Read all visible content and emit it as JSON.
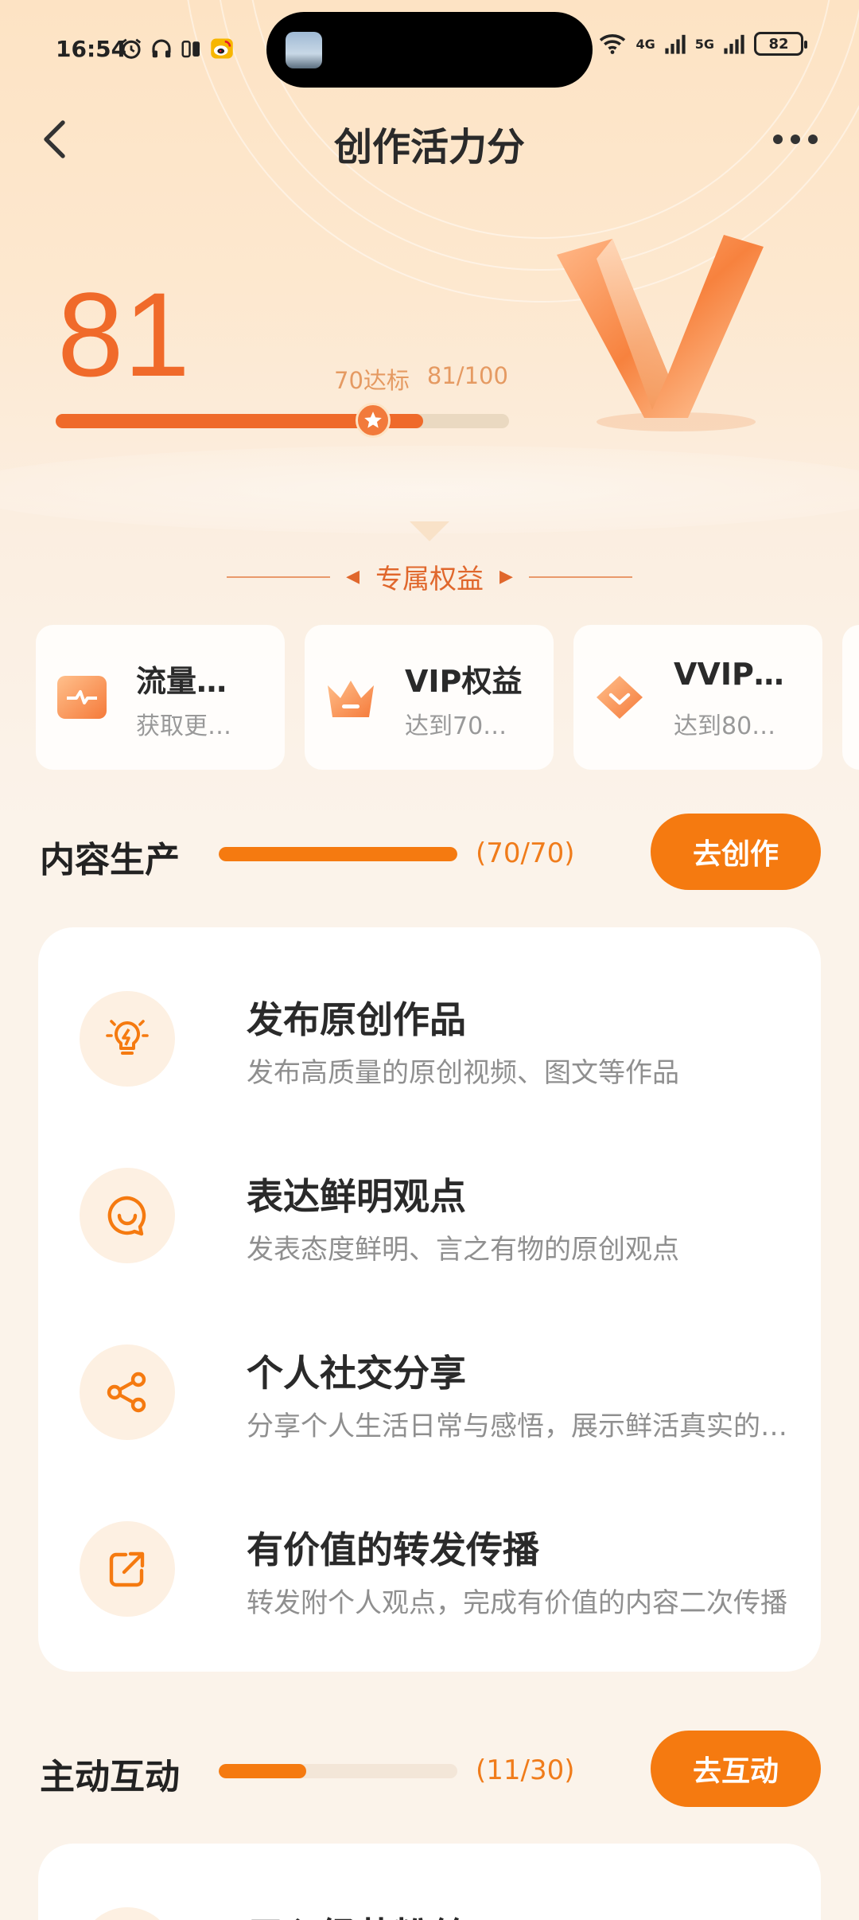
{
  "status_bar": {
    "time": "16:54",
    "net1": "4G",
    "net2": "5G",
    "battery": "82"
  },
  "header": {
    "title": "创作活力分"
  },
  "score": {
    "value": "81",
    "threshold_label": "70达标",
    "progress_label": "81/100",
    "progress": 0.81,
    "threshold": 0.7
  },
  "benefits": {
    "title": "专属权益",
    "cards": [
      {
        "title": "流量…",
        "subtitle": "获取更…"
      },
      {
        "title": "VIP权益",
        "subtitle": "达到70…"
      },
      {
        "title": "VVIP…",
        "subtitle": "达到80…"
      }
    ]
  },
  "sections": [
    {
      "title": "内容生产",
      "count": "(70/70)",
      "progress": 1.0,
      "button": "去创作",
      "tasks": [
        {
          "title": "发布原创作品",
          "subtitle": "发布高质量的原创视频、图文等作品",
          "icon": "bulb-icon"
        },
        {
          "title": "表达鲜明观点",
          "subtitle": "发表态度鲜明、言之有物的原创观点",
          "icon": "smile-chat-icon"
        },
        {
          "title": "个人社交分享",
          "subtitle": "分享个人生活日常与感悟，展示鲜活真实的…",
          "icon": "share-icon"
        },
        {
          "title": "有价值的转发传播",
          "subtitle": "转发附个人观点，完成有价值的内容二次传播",
          "icon": "forward-icon"
        }
      ]
    },
    {
      "title": "主动互动",
      "count": "(11/30)",
      "progress": 0.3667,
      "button": "去互动",
      "tasks": [
        {
          "title": "用心经营粉丝",
          "subtitle": "",
          "icon": "fans-icon"
        }
      ]
    }
  ],
  "colors": {
    "accent": "#f57a10",
    "score": "#f06a2a",
    "bg": "#fbf3ea"
  }
}
